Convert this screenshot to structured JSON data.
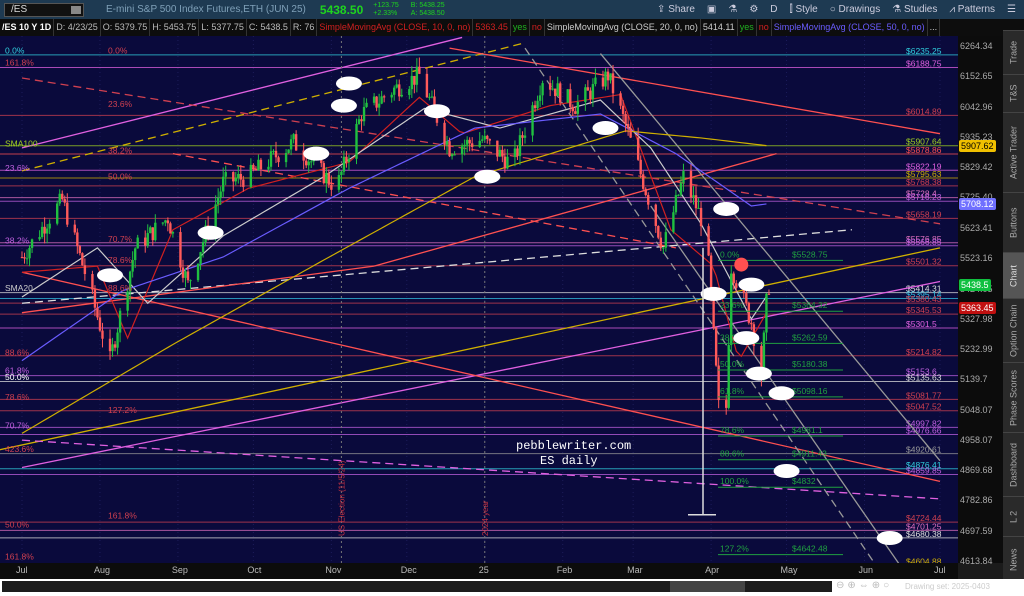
{
  "header": {
    "symbol": "/ES",
    "description": "E-mini S&P 500 Index Futures,ETH (JUN 25)",
    "last": "5438.50",
    "change": "+123.75",
    "change_pct": "+2.33%",
    "bid": "B: 5438.25",
    "ask": "A: 5438.50",
    "tools": [
      {
        "icon": "share-icon",
        "label": "Share"
      },
      {
        "icon": "alert-icon",
        "label": ""
      },
      {
        "icon": "flask-icon",
        "label": ""
      },
      {
        "icon": "gear-icon",
        "label": ""
      },
      {
        "icon": "aggregation",
        "label": "D"
      },
      {
        "icon": "candle-icon",
        "label": "Style"
      },
      {
        "icon": "ellipse-icon",
        "label": "Drawings"
      },
      {
        "icon": "flask-icon",
        "label": "Studies"
      },
      {
        "icon": "pattern-icon",
        "label": "Patterns"
      },
      {
        "icon": "menu-icon",
        "label": "☰"
      }
    ]
  },
  "info": [
    {
      "t": "/ES 10 Y 1D",
      "c": "#ffffff"
    },
    {
      "t": "D: 4/23/25",
      "c": "#bbbbbb"
    },
    {
      "t": "O: 5379.75",
      "c": "#bbbbbb"
    },
    {
      "t": "H: 5453.75",
      "c": "#bbbbbb"
    },
    {
      "t": "L: 5377.75",
      "c": "#bbbbbb"
    },
    {
      "t": "C: 5438.5",
      "c": "#bbbbbb"
    },
    {
      "t": "R: 76",
      "c": "#bbbbbb"
    },
    {
      "t": "SimpleMovingAvg (CLOSE, 10, 0, no)",
      "c": "#d02020"
    },
    {
      "t": "5363.45",
      "c": "#d02020"
    },
    {
      "t": "yes",
      "c": "#20b020"
    },
    {
      "t": "no",
      "c": "#d02020"
    },
    {
      "t": "SimpleMovingAvg (CLOSE, 20, 0, no)",
      "c": "#cccccc"
    },
    {
      "t": "5414.11",
      "c": "#cccccc"
    },
    {
      "t": "yes",
      "c": "#20b020"
    },
    {
      "t": "no",
      "c": "#d02020"
    },
    {
      "t": "SimpleMovingAvg (CLOSE, 50, 0, no)",
      "c": "#6a5cff"
    },
    {
      "t": "...",
      "c": "#cccccc"
    }
  ],
  "sidebar": [
    "Trade",
    "T&S",
    "Active Trader",
    "Buttons",
    "Chart",
    "Option Chain",
    "Phase Scores",
    "Dashboard",
    "L 2",
    "News"
  ],
  "sidebar_selected": "Chart",
  "drawing_set": "Drawing set: 2025-0403",
  "watermark": {
    "line1": "pebblewriter.com",
    "line2": "ES daily"
  },
  "vertical_notes": [
    {
      "text": "US Election (11/5/24)",
      "day": 127
    },
    {
      "text": "2024 year",
      "day": 184
    }
  ],
  "chart_data": {
    "type": "candlestick",
    "scale": "log",
    "ylim": [
      4613.84,
      6264.34
    ],
    "x_ticks": [
      {
        "label": "Jul",
        "day": 0
      },
      {
        "label": "Aug",
        "day": 31
      },
      {
        "label": "Sep",
        "day": 62
      },
      {
        "label": "Oct",
        "day": 92
      },
      {
        "label": "Nov",
        "day": 123
      },
      {
        "label": "Dec",
        "day": 153
      },
      {
        "label": "25",
        "day": 184
      },
      {
        "label": "Feb",
        "day": 215
      },
      {
        "label": "Mar",
        "day": 243
      },
      {
        "label": "Apr",
        "day": 274
      },
      {
        "label": "May",
        "day": 304
      },
      {
        "label": "Jun",
        "day": 335
      },
      {
        "label": "Jul",
        "day": 365
      }
    ],
    "y_ticks": [
      "6264.34",
      "6152.65",
      "6042.96",
      "5935.23",
      "5829.42",
      "5725.40",
      "5623.41",
      "5523.16",
      "5424.05",
      "5327.98",
      "5232.99",
      "5139.7",
      "5048.07",
      "4958.07",
      "4869.68",
      "4782.86",
      "4697.59",
      "4613.84"
    ],
    "price_badges": [
      {
        "v": "5907.62",
        "c": "#f0c000",
        "t": "#000"
      },
      {
        "v": "5708.12",
        "c": "#7070ff",
        "t": "#fff"
      },
      {
        "v": "5438.5",
        "c": "#10c040",
        "t": "#fff"
      },
      {
        "v": "5363.45",
        "c": "#c01010",
        "t": "#fff"
      }
    ],
    "close_path": [
      [
        0,
        5530
      ],
      [
        10,
        5650
      ],
      [
        16,
        5720
      ],
      [
        25,
        5480
      ],
      [
        35,
        5200
      ],
      [
        45,
        5560
      ],
      [
        58,
        5660
      ],
      [
        66,
        5440
      ],
      [
        80,
        5780
      ],
      [
        90,
        5800
      ],
      [
        108,
        5920
      ],
      [
        125,
        5760
      ],
      [
        135,
        6020
      ],
      [
        148,
        6110
      ],
      [
        158,
        6160
      ],
      [
        170,
        5900
      ],
      [
        183,
        5930
      ],
      [
        195,
        5840
      ],
      [
        207,
        6150
      ],
      [
        220,
        6050
      ],
      [
        233,
        6160
      ],
      [
        240,
        5980
      ],
      [
        250,
        5700
      ],
      [
        255,
        5560
      ],
      [
        263,
        5800
      ],
      [
        272,
        5620
      ],
      [
        279,
        4850
      ],
      [
        282,
        5500
      ],
      [
        290,
        5320
      ],
      [
        294,
        5150
      ],
      [
        296,
        5380
      ],
      [
        297,
        5438.5
      ]
    ],
    "sma": [
      {
        "name": "SMA10",
        "c": "#d02020",
        "v": [
          [
            0,
            5480
          ],
          [
            30,
            5500
          ],
          [
            42,
            5270
          ],
          [
            60,
            5620
          ],
          [
            90,
            5760
          ],
          [
            130,
            5850
          ],
          [
            158,
            6080
          ],
          [
            175,
            5950
          ],
          [
            210,
            6050
          ],
          [
            238,
            6090
          ],
          [
            258,
            5620
          ],
          [
            275,
            5500
          ],
          [
            285,
            5200
          ],
          [
            297,
            5363
          ]
        ]
      },
      {
        "name": "SMA20",
        "c": "#cccccc",
        "v": [
          [
            0,
            5400
          ],
          [
            30,
            5560
          ],
          [
            50,
            5380
          ],
          [
            80,
            5600
          ],
          [
            120,
            5800
          ],
          [
            160,
            6040
          ],
          [
            190,
            5970
          ],
          [
            230,
            6070
          ],
          [
            250,
            5900
          ],
          [
            270,
            5640
          ],
          [
            290,
            5330
          ],
          [
            297,
            5414
          ]
        ]
      },
      {
        "name": "SMA50",
        "c": "#6a5cff",
        "v": [
          [
            0,
            5200
          ],
          [
            40,
            5420
          ],
          [
            80,
            5530
          ],
          [
            130,
            5760
          ],
          [
            180,
            5970
          ],
          [
            230,
            6020
          ],
          [
            260,
            5880
          ],
          [
            290,
            5700
          ],
          [
            297,
            5708
          ]
        ]
      },
      {
        "name": "SMA100",
        "c": "#d0b000",
        "v": [
          [
            0,
            4980
          ],
          [
            60,
            5250
          ],
          [
            120,
            5520
          ],
          [
            180,
            5800
          ],
          [
            240,
            5960
          ],
          [
            270,
            5935
          ],
          [
            297,
            5907
          ]
        ]
      }
    ],
    "levels": [
      [
        "6235.25",
        "#30d0e0"
      ],
      [
        "6188.75",
        "#e060e0"
      ],
      [
        "6014.89",
        "#d04050"
      ],
      [
        "5907.64",
        "#a0d020"
      ],
      [
        "5878.86",
        "#ff5050"
      ],
      [
        "5822.19",
        "#e060e0"
      ],
      [
        "5795.63",
        "#d0b000"
      ],
      [
        "5768.38",
        "#d04050"
      ],
      [
        "5728.4",
        "#e070c0"
      ],
      [
        "5716.23",
        "#c060e0"
      ],
      [
        "5658.19",
        "#d04050"
      ],
      [
        "5576.85",
        "#e070c0"
      ],
      [
        "5566.85",
        "#c060e0"
      ],
      [
        "5501.32",
        "#d04050"
      ],
      [
        "5414.31",
        "#dddddd"
      ],
      [
        "5395.14",
        "#30c0e0"
      ],
      [
        "5380.43",
        "#d04050"
      ],
      [
        "5345.53",
        "#d04050"
      ],
      [
        "5301.5",
        "#e060e0"
      ],
      [
        "5214.82",
        "#d04050"
      ],
      [
        "5153.6",
        "#c060e0"
      ],
      [
        "5135.63",
        "#dddddd"
      ],
      [
        "5081.77",
        "#d04050"
      ],
      [
        "5047.52",
        "#d04050"
      ],
      [
        "4997.82",
        "#c060e0"
      ],
      [
        "4976.66",
        "#c060e0"
      ],
      [
        "4920.61",
        "#999999"
      ],
      [
        "4876.41",
        "#30d0e0"
      ],
      [
        "4859.85",
        "#c060e0"
      ],
      [
        "4724.44",
        "#d04050"
      ],
      [
        "4701.25",
        "#e070c0"
      ],
      [
        "4680.38",
        "#dddddd"
      ],
      [
        "4604.88",
        "#d0b000"
      ]
    ],
    "fib_right": [
      [
        "0.0%",
        "$5528.75",
        5528.75
      ],
      [
        "23.6%",
        "$5364.32",
        5364.32
      ],
      [
        "38.2%",
        "$5262.59",
        5262.59
      ],
      [
        "50.0%",
        "$5180.38",
        5180.38
      ],
      [
        "61.8%",
        "$5098.16",
        5098.16
      ],
      [
        "78.6%",
        "$4981.1",
        4981.1
      ],
      [
        "88.6%",
        "$4911.43",
        4911.43
      ],
      [
        "100.0%",
        "$4832",
        4832
      ],
      [
        "127.2%",
        "$4642.48",
        4642.48
      ]
    ],
    "left_labels": [
      [
        "0.0%",
        6240,
        "#30d0e0",
        2
      ],
      [
        "0.0%",
        6240,
        "#d04050",
        40
      ],
      [
        "161.8%",
        6195,
        "#d04050",
        2
      ],
      [
        "23.6%",
        6045,
        "#d04050",
        40
      ],
      [
        "SMA100",
        5905,
        "#a0d020",
        2
      ],
      [
        "38.2%",
        5880,
        "#d04050",
        40
      ],
      [
        "23.6%",
        5820,
        "#c060e0",
        2
      ],
      [
        "50.0%",
        5790,
        "#d04050",
        40
      ],
      [
        "38.2%",
        5575,
        "#c060e0",
        2
      ],
      [
        "70.7%",
        5580,
        "#d04050",
        40
      ],
      [
        "78.6%",
        5510,
        "#d04050",
        40
      ],
      [
        "SMA20",
        5420,
        "#cccccc",
        2
      ],
      [
        "88.6%",
        5420,
        "#d04050",
        40
      ],
      [
        "88.6%",
        5215,
        "#d04050",
        2
      ],
      [
        "61.8%",
        5160,
        "#c060e0",
        2
      ],
      [
        "50.0%",
        5140,
        "#ffffff",
        2
      ],
      [
        "78.6%",
        5080,
        "#d04050",
        2
      ],
      [
        "127.2%",
        5040,
        "#d04050",
        40
      ],
      [
        "70.7%",
        4995,
        "#c060e0",
        2
      ],
      [
        "423.6%",
        4925,
        "#d04050",
        2
      ],
      [
        "161.8%",
        4735,
        "#d04050",
        40
      ],
      [
        "50.0%",
        4710,
        "#d04050",
        2
      ],
      [
        "161.8%",
        4620,
        "#d04050",
        2
      ]
    ],
    "trendlines": [
      [
        0,
        5900,
        175,
        6300,
        "#e060e0",
        0
      ],
      [
        0,
        5820,
        200,
        6280,
        "#d0b000",
        1
      ],
      [
        -10,
        4930,
        365,
        5560,
        "#d0b000",
        0
      ],
      [
        0,
        4880,
        365,
        5450,
        "#e060e0",
        0
      ],
      [
        0,
        5380,
        330,
        5620,
        "#dddddd",
        1
      ],
      [
        0,
        4960,
        365,
        4790,
        "#e060e0",
        1
      ],
      [
        0,
        5480,
        365,
        4840,
        "#ff5050",
        0
      ],
      [
        0,
        6150,
        365,
        5640,
        "#d04050",
        1
      ],
      [
        170,
        6260,
        365,
        5950,
        "#ff5050",
        0
      ],
      [
        0,
        5350,
        140,
        5500,
        "#ff5050",
        0
      ],
      [
        140,
        5500,
        300,
        5880,
        "#ff5050",
        0
      ],
      [
        200,
        6260,
        340,
        4600,
        "#999999",
        1
      ],
      [
        230,
        6240,
        365,
        4900,
        "#999999",
        0
      ],
      [
        250,
        5700,
        365,
        4450,
        "#999999",
        0
      ],
      [
        60,
        5880,
        260,
        5560,
        "#ff5050",
        1
      ]
    ],
    "markers": [
      [
        130,
        6130
      ],
      [
        128,
        6050
      ],
      [
        117,
        5880
      ],
      [
        165,
        6030
      ],
      [
        185,
        5800
      ],
      [
        232,
        5970
      ],
      [
        75,
        5610
      ],
      [
        35,
        5470
      ],
      [
        280,
        5690
      ],
      [
        290,
        5440
      ],
      [
        275,
        5410
      ],
      [
        293,
        5160
      ],
      [
        304,
        4870
      ],
      [
        302,
        5100
      ],
      [
        288,
        5270
      ],
      [
        345,
        4680
      ]
    ]
  }
}
